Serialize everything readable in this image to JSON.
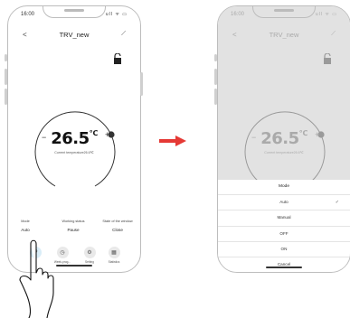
{
  "left_screen": {
    "status_time": "16:00",
    "status_icons": "ull ᯤ ▭",
    "nav": {
      "back": "<",
      "title": "TRV_new",
      "edit": "⟋"
    },
    "temperature": "26.5",
    "unit": "℃",
    "current_temp_label": "Current temperature26.6℃",
    "minus": "−",
    "plus": "+",
    "info": [
      {
        "label": "Mode",
        "value": "Auto"
      },
      {
        "label": "Working status",
        "value": "Pause"
      },
      {
        "label": "State of the window",
        "value": "Close"
      }
    ],
    "bottom_items": [
      {
        "label": "",
        "icon": "power-icon"
      },
      {
        "label": "Week-prog...",
        "icon": "clock-icon"
      },
      {
        "label": "Setting",
        "icon": "gear-icon"
      },
      {
        "label": "Statistics",
        "icon": "calendar-icon"
      }
    ]
  },
  "right_screen": {
    "status_time": "16:00",
    "status_icons": "ull ᯤ ▭",
    "nav": {
      "back": "<",
      "title": "TRV_new",
      "edit": "⟋"
    },
    "temperature": "26.5",
    "unit": "℃",
    "current_temp_label": "Current temperature26.6℃",
    "minus": "−",
    "plus": "+",
    "sheet": {
      "title": "Mode",
      "options": [
        "Auto",
        "Manual",
        "OFF",
        "ON"
      ],
      "selected": "Auto",
      "check": "✓",
      "cancel": "Cancel"
    }
  },
  "colors": {
    "accent": "#e53935",
    "knob": "#333333",
    "dim": "#e2e2e2"
  }
}
